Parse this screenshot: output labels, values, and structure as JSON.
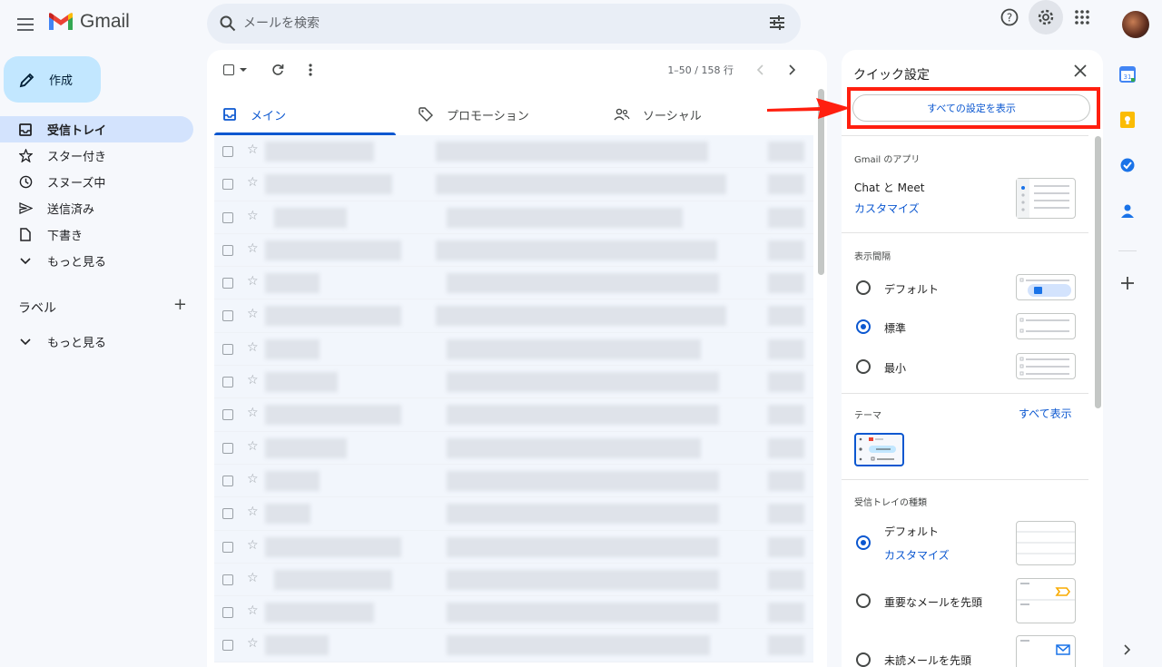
{
  "app": {
    "name": "Gmail"
  },
  "search": {
    "placeholder": "メールを検索"
  },
  "compose": {
    "label": "作成"
  },
  "sidebar": {
    "items": [
      {
        "label": "受信トレイ",
        "icon": "inbox-icon",
        "active": true
      },
      {
        "label": "スター付き",
        "icon": "star-icon"
      },
      {
        "label": "スヌーズ中",
        "icon": "clock-icon"
      },
      {
        "label": "送信済み",
        "icon": "send-icon"
      },
      {
        "label": "下書き",
        "icon": "draft-icon"
      },
      {
        "label": "もっと見る",
        "icon": "chevron-down-icon"
      }
    ],
    "labels_title": "ラベル",
    "labels_more": "もっと見る"
  },
  "toolbar": {
    "range": "1–50 / 158 行"
  },
  "tabs": [
    {
      "label": "メイン",
      "icon": "inbox-icon",
      "active": true
    },
    {
      "label": "プロモーション",
      "icon": "tag-icon"
    },
    {
      "label": "ソーシャル",
      "icon": "people-icon"
    }
  ],
  "quick_settings": {
    "title": "クイック設定",
    "all_settings": "すべての設定を表示",
    "apps_header": "Gmail のアプリ",
    "apps_label": "Chat と Meet",
    "apps_link": "カスタマイズ",
    "density_header": "表示間隔",
    "density_options": [
      {
        "label": "デフォルト",
        "selected": false
      },
      {
        "label": "標準",
        "selected": true
      },
      {
        "label": "最小",
        "selected": false
      }
    ],
    "theme_header": "テーマ",
    "theme_link": "すべて表示",
    "inbox_type_header": "受信トレイの種類",
    "inbox_types": [
      {
        "label": "デフォルト",
        "selected": true,
        "link": "カスタマイズ"
      },
      {
        "label": "重要なメールを先頭",
        "selected": false
      },
      {
        "label": "未読メールを先頭",
        "selected": false
      }
    ]
  },
  "colors": {
    "accent": "#0b57d0",
    "highlight": "#ff1f0f",
    "nav_active": "#d3e3fd",
    "compose": "#c2e7ff"
  }
}
